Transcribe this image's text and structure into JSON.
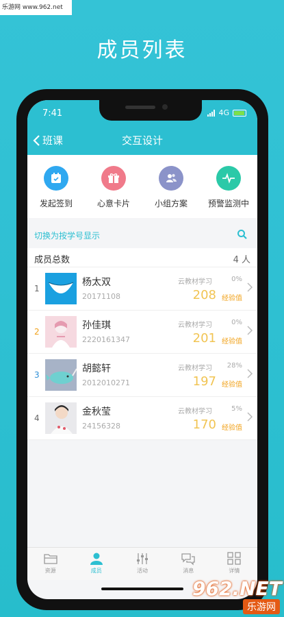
{
  "watermark": {
    "site": "乐游网 www.962.net",
    "logo": "962.NET",
    "logo_sub": "乐游网"
  },
  "promo_title": "成员列表",
  "status_bar": {
    "time": "7:41",
    "network": "4G"
  },
  "nav": {
    "back_label": "班课",
    "title": "交互设计"
  },
  "quick_actions": [
    {
      "label": "发起签到",
      "icon": "calendar-icon",
      "color": "#2fa8f0"
    },
    {
      "label": "心意卡片",
      "icon": "gift-icon",
      "color": "#f07a8a"
    },
    {
      "label": "小组方案",
      "icon": "group-icon",
      "color": "#8b93c9"
    },
    {
      "label": "预警监测中",
      "icon": "pulse-icon",
      "color": "#2bc9a8"
    }
  ],
  "switch_row": {
    "label": "切换为按学号显示"
  },
  "member_count": {
    "label": "成员总数",
    "value": "4 人"
  },
  "members": [
    {
      "rank": "1",
      "rank_color": "#666666",
      "name": "杨太双",
      "id": "20171108",
      "source": "云教材学习",
      "percent": "0%",
      "exp": "208",
      "exp_label": "经验值"
    },
    {
      "rank": "2",
      "rank_color": "#f1a21b",
      "name": "孙佳琪",
      "id": "2220161347",
      "source": "云教材学习",
      "percent": "0%",
      "exp": "201",
      "exp_label": "经验值"
    },
    {
      "rank": "3",
      "rank_color": "#2f8fd6",
      "name": "胡懿轩",
      "id": "2012010271",
      "source": "云教材学习",
      "percent": "28%",
      "exp": "197",
      "exp_label": "经验值"
    },
    {
      "rank": "4",
      "rank_color": "#666666",
      "name": "金秋莹",
      "id": "24156328",
      "source": "云教材学习",
      "percent": "5%",
      "exp": "170",
      "exp_label": "经验值"
    }
  ],
  "tabbar": [
    {
      "label": "资源",
      "icon": "folder-icon",
      "active": false
    },
    {
      "label": "成员",
      "icon": "person-icon",
      "active": true
    },
    {
      "label": "活动",
      "icon": "sliders-icon",
      "active": false
    },
    {
      "label": "消息",
      "icon": "chat-icon",
      "active": false
    },
    {
      "label": "详情",
      "icon": "grid-icon",
      "active": false
    }
  ]
}
